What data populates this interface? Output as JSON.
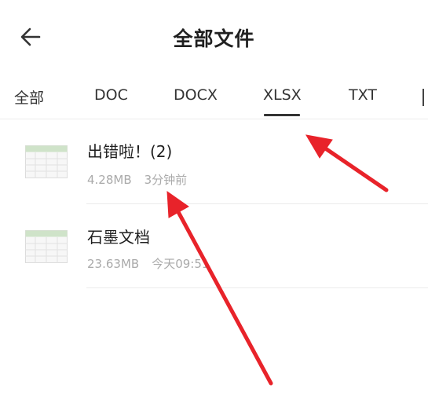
{
  "header": {
    "title": "全部文件",
    "back_icon": "arrow-left-icon"
  },
  "tabs": [
    {
      "label": "全部"
    },
    {
      "label": "DOC"
    },
    {
      "label": "DOCX"
    },
    {
      "label": "XLSX",
      "selected": true
    },
    {
      "label": "TXT"
    }
  ],
  "files": [
    {
      "name": "出错啦！(2)",
      "size": "4.28MB",
      "time": "3分钟前",
      "icon": "spreadsheet-icon"
    },
    {
      "name": "石墨文档",
      "size": "23.63MB",
      "time": "今天09:51",
      "icon": "spreadsheet-icon"
    }
  ],
  "colors": {
    "annotation_arrow": "#e8232a",
    "sheet_header": "#cfe3c9"
  }
}
